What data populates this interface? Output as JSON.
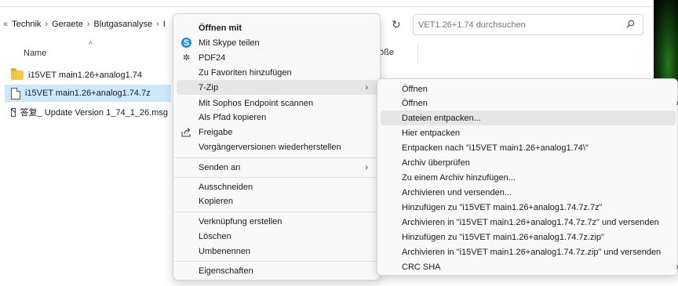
{
  "explorer": {
    "breadcrumb": {
      "overflow": "«",
      "items": [
        "Technik",
        "Geraete",
        "Blutgasanalyse",
        "I"
      ]
    },
    "search": {
      "placeholder": "VET1.26+1.74 durchsuchen"
    },
    "columns": {
      "name": "Name",
      "size_partial": "öße"
    },
    "files": [
      {
        "name": "i15VET main1.26+analog1.74",
        "type": "folder-icon"
      },
      {
        "name": "i15VET main1.26+analog1.74.7z",
        "type": "doc-icon",
        "selected": true
      },
      {
        "name": "答复_ Update Version 1_74_1_26.msg",
        "type": "mail-icon"
      }
    ]
  },
  "context_menu": {
    "items": [
      {
        "label": "Öffnen mit",
        "bold": true
      },
      {
        "label": "Mit Skype teilen",
        "icon": "skype-icon"
      },
      {
        "label": "PDF24",
        "icon": "pdf24-icon"
      },
      {
        "label": "Zu Favoriten hinzufügen"
      },
      {
        "label": "7-Zip",
        "submenu": true,
        "active": true
      },
      {
        "label": "Mit Sophos Endpoint scannen"
      },
      {
        "label": "Als Pfad kopieren"
      },
      {
        "label": "Freigabe",
        "icon": "share-icon"
      },
      {
        "label": "Vorgängerversionen wiederherstellen"
      },
      {
        "label": "Senden an",
        "submenu": true
      },
      {
        "label": "Ausschneiden"
      },
      {
        "label": "Kopieren"
      },
      {
        "label": "Verknüpfung erstellen"
      },
      {
        "label": "Löschen"
      },
      {
        "label": "Umbenennen"
      },
      {
        "label": "Eigenschaften"
      }
    ],
    "arrow_glyph": "›"
  },
  "submenu_7zip": {
    "items": [
      {
        "label": "Öffnen"
      },
      {
        "label": "Öffnen",
        "submenu": true
      },
      {
        "label": "Dateien entpacken...",
        "active": true
      },
      {
        "label": "Hier entpacken"
      },
      {
        "label": "Entpacken nach \"i15VET main1.26+analog1.74\\\""
      },
      {
        "label": "Archiv überprüfen"
      },
      {
        "label": "Zu einem Archiv hinzufügen..."
      },
      {
        "label": "Archivieren und versenden..."
      },
      {
        "label": "Hinzufügen zu \"i15VET main1.26+analog1.74.7z.7z\""
      },
      {
        "label": "Archivieren in \"i15VET main1.26+analog1.74.7z.7z\" und versenden"
      },
      {
        "label": "Hinzufügen zu \"i15VET main1.26+analog1.74.7z.zip\""
      },
      {
        "label": "Archivieren in \"i15VET main1.26+analog1.74.7z.zip\" und versenden"
      },
      {
        "label": "CRC SHA",
        "submenu": true
      }
    ]
  },
  "colors": {
    "selection": "#cce8ff",
    "menu_bg": "#f9f9f9",
    "menu_hover": "#e6e6e6",
    "skype": "#1e8ede",
    "folder": "#f2c744"
  }
}
